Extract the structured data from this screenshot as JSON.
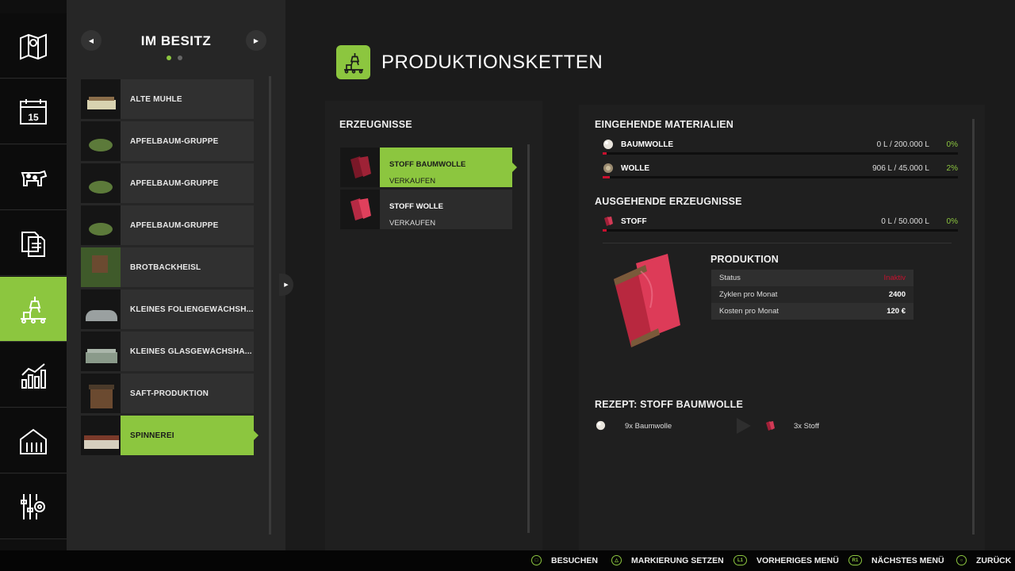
{
  "nav": {
    "items": [
      {
        "icon": "map-icon"
      },
      {
        "icon": "calendar-icon",
        "day": "15"
      },
      {
        "icon": "cow-icon"
      },
      {
        "icon": "contracts-icon"
      },
      {
        "icon": "production-icon",
        "active": true
      },
      {
        "icon": "statistics-icon"
      },
      {
        "icon": "barn-icon"
      },
      {
        "icon": "settings-icon"
      }
    ]
  },
  "owned": {
    "title": "IM BESITZ",
    "items": [
      {
        "label": "ALTE MÜHLE"
      },
      {
        "label": "APFELBAUM-GRUPPE"
      },
      {
        "label": "APFELBAUM-GRUPPE"
      },
      {
        "label": "APFELBAUM-GRUPPE"
      },
      {
        "label": "BROTBACKHEISL"
      },
      {
        "label": "KLEINES FOLIENGEWÄCHSH..."
      },
      {
        "label": "KLEINES GLASGEWÄCHSHA..."
      },
      {
        "label": "SAFT-PRODUKTION"
      },
      {
        "label": "SPINNEREI",
        "active": true
      }
    ]
  },
  "main": {
    "title": "PRODUKTIONSKETTEN",
    "products_title": "ERZEUGNISSE",
    "products": [
      {
        "name": "STOFF BAUMWOLLE",
        "action": "VERKAUFEN",
        "active": true
      },
      {
        "name": "STOFF WOLLE",
        "action": "VERKAUFEN"
      }
    ],
    "incoming_title": "EINGEHENDE MATERIALIEN",
    "incoming": [
      {
        "name": "BAUMWOLLE",
        "amount": "0 L / 200.000 L",
        "percent": "0%",
        "fill": 0.0
      },
      {
        "name": "WOLLE",
        "amount": "906 L / 45.000 L",
        "percent": "2%",
        "fill": 0.02
      }
    ],
    "outgoing_title": "AUSGEHENDE ERZEUGNISSE",
    "outgoing": [
      {
        "name": "STOFF",
        "amount": "0 L / 50.000 L",
        "percent": "0%",
        "fill": 0.0
      }
    ],
    "production": {
      "title": "PRODUKTION",
      "rows": [
        {
          "key": "Status",
          "value": "Inaktiv"
        },
        {
          "key": "Zyklen pro Monat",
          "value": "2400"
        },
        {
          "key": "Kosten pro Monat",
          "value": "120 €"
        }
      ]
    },
    "recipe": {
      "title": "REZEPT: STOFF BAUMWOLLE",
      "input": "9x Baumwolle",
      "output": "3x Stoff"
    }
  },
  "footer": {
    "search": "BESUCHEN",
    "mark": "MARKIERUNG SETZEN",
    "prev": "VORHERIGES MENÜ",
    "next": "NÄCHSTES MENÜ",
    "back": "ZURÜCK",
    "prev_key": "L1",
    "next_key": "R1"
  },
  "colors": {
    "accent": "#8cc63f",
    "warn": "#c8102e",
    "panel": "#262626"
  }
}
